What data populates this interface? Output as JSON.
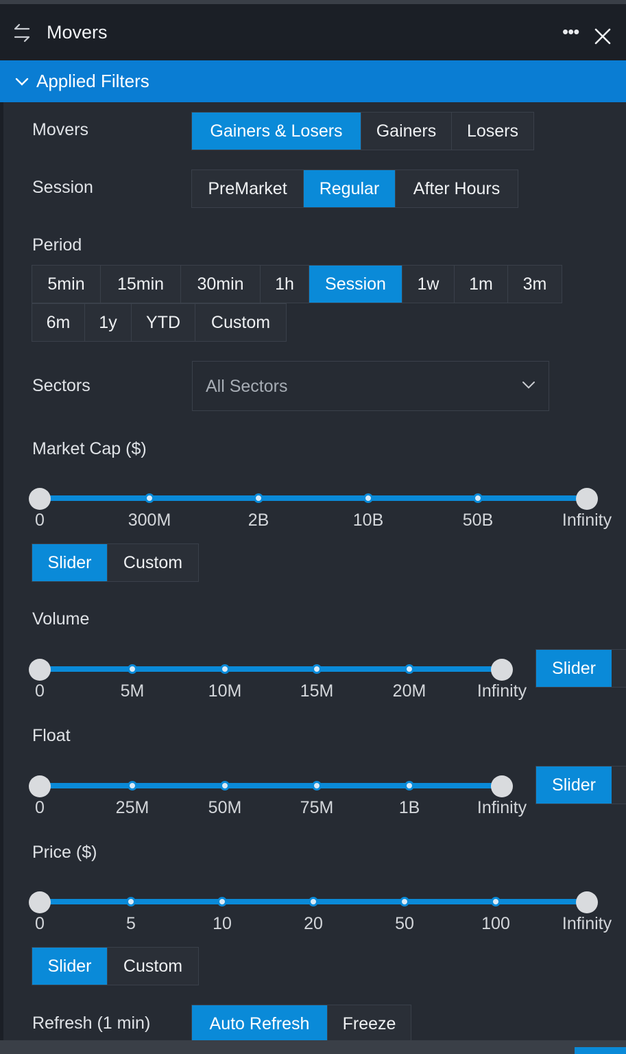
{
  "header": {
    "title": "Movers",
    "icons": {
      "swap": "swap-arrows-icon",
      "more": "more-icon",
      "close": "close-icon"
    },
    "more_glyph": "•••"
  },
  "filters_bar": {
    "label": "Applied Filters"
  },
  "colors": {
    "accent": "#0a8ad8",
    "header_blue": "#0a7dd3",
    "background": "#262b33"
  },
  "movers": {
    "label": "Movers",
    "options": [
      "Gainers & Losers",
      "Gainers",
      "Losers"
    ],
    "selected": "Gainers & Losers"
  },
  "session": {
    "label": "Session",
    "options": [
      "PreMarket",
      "Regular",
      "After Hours"
    ],
    "selected": "Regular"
  },
  "period": {
    "label": "Period",
    "row1": [
      "5min",
      "15min",
      "30min",
      "1h",
      "Session",
      "1w",
      "1m",
      "3m"
    ],
    "row2": [
      "6m",
      "1y",
      "YTD",
      "Custom"
    ],
    "selected": "Session"
  },
  "sectors": {
    "label": "Sectors",
    "value": "All Sectors"
  },
  "market_cap": {
    "label": "Market Cap ($)",
    "ticks": [
      "0",
      "300M",
      "2B",
      "10B",
      "50B",
      "Infinity"
    ],
    "range": [
      "0",
      "Infinity"
    ],
    "modes": [
      "Slider",
      "Custom"
    ],
    "mode": "Slider"
  },
  "volume": {
    "label": "Volume",
    "ticks": [
      "0",
      "5M",
      "10M",
      "15M",
      "20M",
      "Infinity"
    ],
    "range": [
      "0",
      "Infinity"
    ],
    "mode_label": "Slider"
  },
  "float": {
    "label": "Float",
    "ticks": [
      "0",
      "25M",
      "50M",
      "75M",
      "1B",
      "Infinity"
    ],
    "range": [
      "0",
      "Infinity"
    ],
    "mode_label": "Slider"
  },
  "price": {
    "label": "Price ($)",
    "ticks": [
      "0",
      "5",
      "10",
      "20",
      "50",
      "100",
      "Infinity"
    ],
    "range": [
      "0",
      "Infinity"
    ],
    "modes": [
      "Slider",
      "Custom"
    ],
    "mode": "Slider"
  },
  "refresh": {
    "label": "Refresh (1 min)",
    "options": [
      "Auto Refresh",
      "Freeze"
    ],
    "selected": "Auto Refresh"
  }
}
